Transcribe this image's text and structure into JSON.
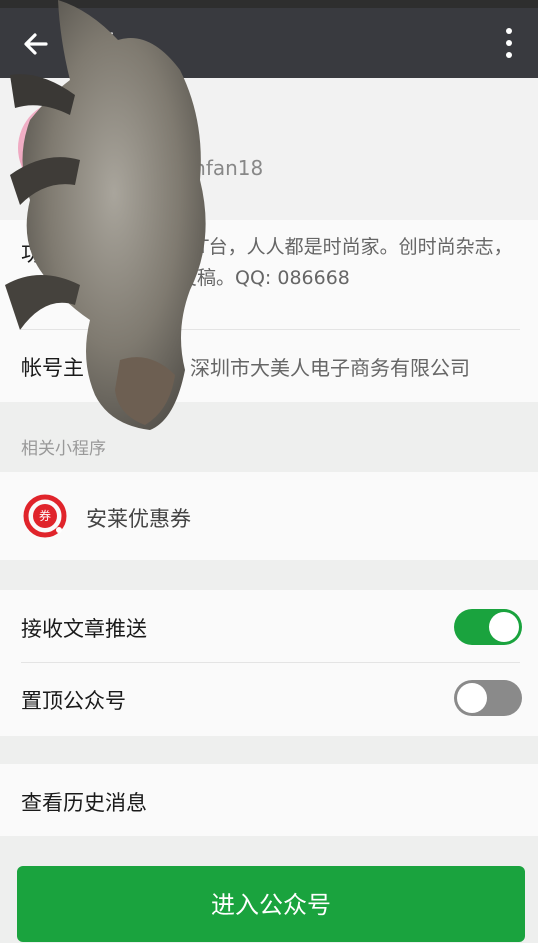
{
  "header": {
    "title": "节",
    "back_icon": "arrow-left-icon",
    "more_icon": "more-vertical-icon"
  },
  "profile": {
    "name": "",
    "wechat_id": "ashionfan18"
  },
  "info": {
    "function_label": "功能",
    "function_text": "创时尚T台，人人都是时尚家。创时尚杂志，欢迎投稿。QQ: 086668",
    "owner_label": "帐号主",
    "owner_text": "深圳市大美人电子商务有限公司"
  },
  "mini_programs": {
    "section_title": "相关小程序",
    "items": [
      {
        "name": "安莱优惠券",
        "icon_text": "券",
        "icon": "coupon-icon"
      }
    ]
  },
  "settings": {
    "receive_articles": {
      "label": "接收文章推送",
      "on": true
    },
    "pin_top": {
      "label": "置顶公众号",
      "on": false
    }
  },
  "history": {
    "label": "查看历史消息"
  },
  "enter_button": {
    "label": "进入公众号"
  },
  "colors": {
    "titlebar": "#393a3f",
    "accent_green": "#1aa33e",
    "toggle_off": "#8a8a8a"
  }
}
